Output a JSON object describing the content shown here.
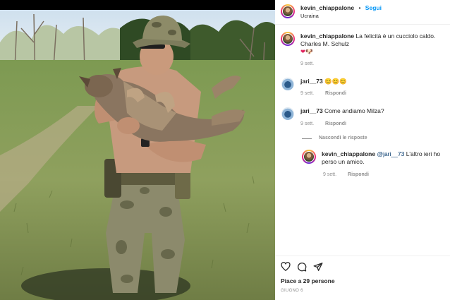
{
  "post_header": {
    "username": "kevin_chiappalone",
    "separator": "•",
    "follow_label": "Segui",
    "location": "Ucraina"
  },
  "caption": {
    "username": "kevin_chiappalone",
    "text": "La felicità è un cucciolo caldo. Charles M. Schulz",
    "emoji": "❤🐶",
    "time": "9 sett."
  },
  "comments": [
    {
      "username": "jari__73",
      "text": "😊😊😊",
      "time": "9 sett.",
      "reply_label": "Rispondi"
    },
    {
      "username": "jari__73",
      "text": "Come andiamo Milza?",
      "time": "9 sett.",
      "reply_label": "Rispondi"
    }
  ],
  "hide_replies_label": "Nascondi le risposte",
  "reply": {
    "username": "kevin_chiappalone",
    "mention": "@jari__73",
    "text": "L'altro ieri ho perso un amico.",
    "time": "9 sett.",
    "reply_label": "Rispondi"
  },
  "likes_text": "Piace a 29 persone",
  "post_date": "GIUGNO 6",
  "icons": [
    "heart-icon",
    "comment-icon",
    "share-icon"
  ],
  "colors": {
    "link": "#0095f6",
    "muted": "#8e8e8e",
    "text": "#262626"
  }
}
